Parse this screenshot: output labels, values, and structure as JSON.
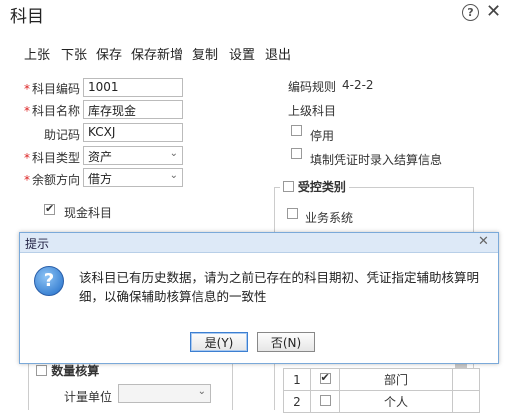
{
  "window": {
    "title": "科目"
  },
  "toolbar": {
    "items": [
      "上张",
      "下张",
      "保存",
      "保存新增",
      "复制",
      "设置",
      "退出"
    ]
  },
  "form": {
    "code_label": "科目编码",
    "code_value": "1001",
    "name_label": "科目名称",
    "name_value": "库存现金",
    "mnemonic_label": "助记码",
    "mnemonic_value": "KCXJ",
    "type_label": "科目类型",
    "type_value": "资产",
    "direction_label": "余额方向",
    "direction_value": "借方",
    "cash_label": "现金科目"
  },
  "right": {
    "rule_label": "编码规则",
    "rule_value": "4-2-2",
    "parent_label": "上级科目",
    "disabled_label": "停用",
    "voucher_label": "填制凭证时录入结算信息",
    "controlled_label": "受控类别",
    "business_label": "业务系统"
  },
  "bottom": {
    "quantity_label": "数量核算",
    "unit_label": "计量单位"
  },
  "aux_table": {
    "rows": [
      {
        "no": "1",
        "checked": true,
        "name": "部门"
      },
      {
        "no": "2",
        "checked": false,
        "name": "个人"
      }
    ]
  },
  "dialog": {
    "title": "提示",
    "message": "该科目已有历史数据，请为之前已存在的科目期初、凭证指定辅助核算明细，以确保辅助核算信息的一致性",
    "yes_label": "是(Y)",
    "no_label": "否(N)"
  }
}
